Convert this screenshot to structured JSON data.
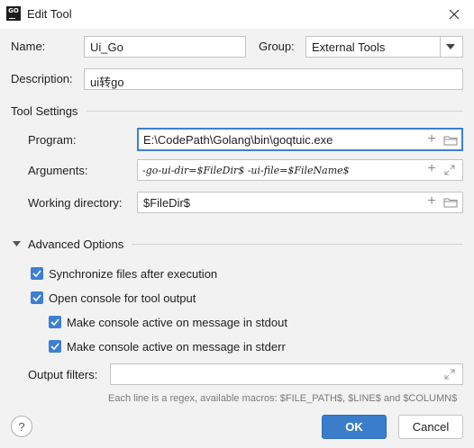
{
  "window": {
    "title": "Edit Tool",
    "app_icon_text": "GO"
  },
  "form": {
    "name_label": "Name:",
    "name_value": "Ui_Go",
    "group_label": "Group:",
    "group_value": "External Tools",
    "description_label": "Description:",
    "description_value": "ui转go"
  },
  "tool_settings": {
    "section_title": "Tool Settings",
    "program_label": "Program:",
    "program_value": "E:\\CodePath\\Golang\\bin\\goqtuic.exe",
    "arguments_label": "Arguments:",
    "arguments_value": "-go-ui-dir=$FileDir$ -ui-file=$FileName$",
    "workdir_label": "Working directory:",
    "workdir_value": "$FileDir$"
  },
  "advanced": {
    "section_title": "Advanced Options",
    "options": [
      {
        "label": "Synchronize files after execution",
        "checked": true
      },
      {
        "label": "Open console for tool output",
        "checked": true
      },
      {
        "label": "Make console active on message in stdout",
        "checked": true
      },
      {
        "label": "Make console active on message in stderr",
        "checked": true
      }
    ],
    "output_filters_label": "Output filters:",
    "output_filters_value": "",
    "hint": "Each line is a regex, available macros: $FILE_PATH$, $LINE$ and $COLUMN$"
  },
  "buttons": {
    "help": "?",
    "ok": "OK",
    "cancel": "Cancel"
  },
  "colors": {
    "accent": "#3d7fd5",
    "ok_button": "#3a7ecb",
    "background": "#f2f2f2"
  }
}
